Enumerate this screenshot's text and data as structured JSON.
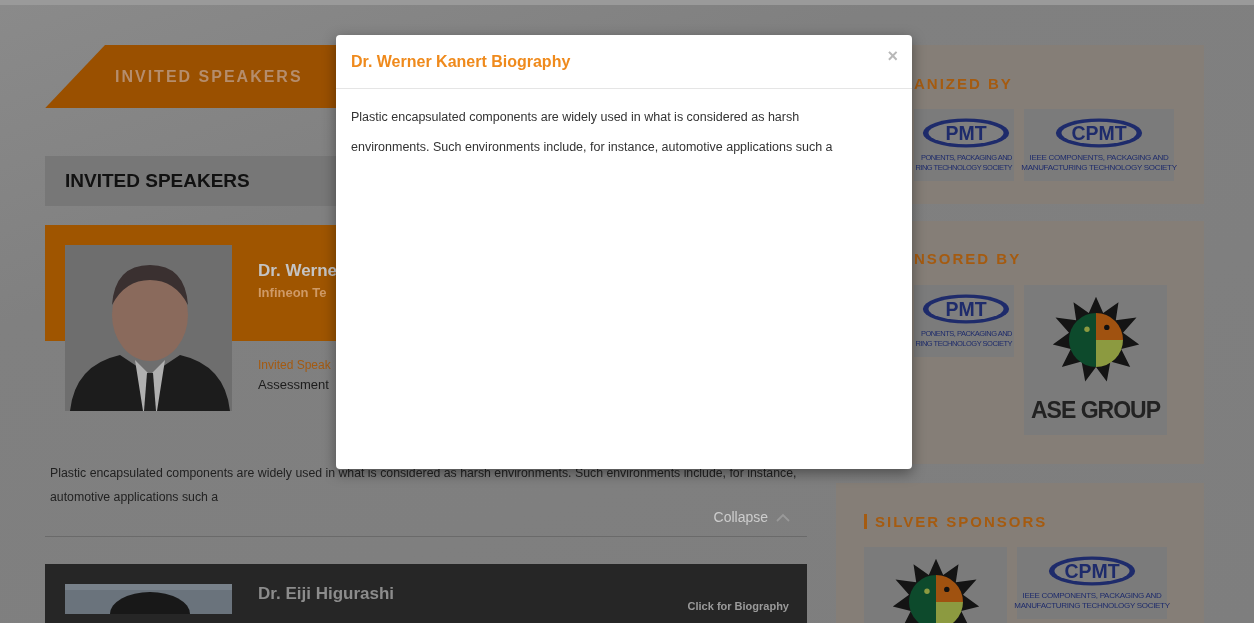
{
  "banner": {
    "title": "INVITED SPEAKERS"
  },
  "section_heading": "INVITED SPEAKERS",
  "speakers": [
    {
      "name": "Dr. Werne",
      "affiliation": "Infineon Te",
      "role": "Invited Speak",
      "talk": "Assessment",
      "expanded": true,
      "bio": "Plastic encapsulated components are widely used in what is considered as harsh environments. Such environments include, for instance, automotive applications such a",
      "toggle": "Collapse"
    },
    {
      "name": "Dr. Eiji Higurashi",
      "expanded": false,
      "link": "Click for Biography"
    }
  ],
  "sidebar": [
    {
      "title": "ANIZED BY",
      "marker": false,
      "logos": [
        {
          "kind": "cpmt",
          "mark": "PMT",
          "caption": [
            "PONENTS, PACKAGING AND",
            "RING TECHNOLOGY SOCIETY"
          ]
        },
        {
          "kind": "cpmt",
          "mark": "CPMT",
          "caption": [
            "IEEE COMPONENTS, PACKAGING AND",
            "MANUFACTURING TECHNOLOGY SOCIETY"
          ]
        }
      ]
    },
    {
      "title": "NSORED BY",
      "marker": false,
      "logos": [
        {
          "kind": "cpmt",
          "mark": "PMT",
          "caption": [
            "PONENTS, PACKAGING AND",
            "RING TECHNOLOGY SOCIETY"
          ]
        },
        {
          "kind": "ase",
          "caption": "ASE GROUP"
        }
      ]
    },
    {
      "title": "SILVER SPONSORS",
      "marker": true,
      "logos": [
        {
          "kind": "ase"
        },
        {
          "kind": "cpmt",
          "mark": "CPMT",
          "caption": [
            "IEEE COMPONENTS, PACKAGING AND",
            "MANUFACTURING TECHNOLOGY SOCIETY"
          ]
        }
      ]
    }
  ],
  "modal": {
    "title": "Dr. Werner Kanert Biography",
    "close": "×",
    "body": "Plastic encapsulated components are widely used in what is considered as harsh environments. Such environments include, for instance, automotive applications such a"
  }
}
